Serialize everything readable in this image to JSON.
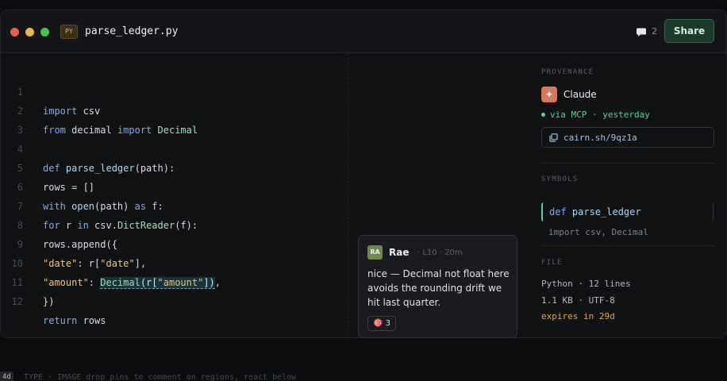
{
  "window": {
    "file_type": "PY",
    "filename": "parse_ledger.py",
    "comment_count": "2",
    "share_label": "Share"
  },
  "code": {
    "lines": [
      {
        "n": "1"
      },
      {
        "n": "2"
      },
      {
        "n": "3"
      },
      {
        "n": "4"
      },
      {
        "n": "5"
      },
      {
        "n": "6"
      },
      {
        "n": "7"
      },
      {
        "n": "8"
      },
      {
        "n": "9"
      },
      {
        "n": "10"
      },
      {
        "n": "11"
      },
      {
        "n": "12"
      }
    ],
    "t": {
      "import": "import",
      "csv": " csv",
      "from": "from",
      "decimal_mod": " decimal ",
      "import2": "import",
      "Decimal": " Decimal",
      "def": "def",
      "parse_ledger": " parse_ledger",
      "path_sig": "(path):",
      "rows_eq": "rows = []",
      "with": "with",
      "open": " open",
      "path_as": "(path) ",
      "as": "as",
      "f": " f:",
      "for": "for",
      "r": " r ",
      "in": "in",
      "csv_dot": " csv.",
      "DictReader": "DictReader",
      "f_paren": "(f):",
      "rows_append": "rows.append({",
      "date_key": "\"date\"",
      "colon_r": ": r[",
      "date_key2": "\"date\"",
      "close_comma": "],",
      "amount_key": "\"amount\"",
      "colon": ": ",
      "Decimal_call": "Decimal",
      "r_open": "(r[",
      "amount_key2": "\"amount\"",
      "close2": "])",
      "comma": ",",
      "close_brace": "})",
      "return": "return",
      "rows": " rows"
    }
  },
  "comment": {
    "initials": "RA",
    "author": "Rae",
    "meta": "· L10 · 20m",
    "body": "nice — Decimal not float here avoids the rounding drift we hit last quarter.",
    "reaction_emoji": "🎯",
    "reaction_count": "3"
  },
  "provenance": {
    "label": "PROVENANCE",
    "badge_glyph": "✦",
    "name": "Claude",
    "via": "via MCP · yesterday",
    "link": "cairn.sh/9qz1a"
  },
  "symbols": {
    "label": "SYMBOLS",
    "active_kw": "def",
    "active_name": " parse_ledger",
    "secondary": "import csv, Decimal"
  },
  "file": {
    "label": "FILE",
    "lang_lines": "Python · 12 lines",
    "size_enc": "1.1 KB · UTF-8",
    "expires": "expires in 29d"
  },
  "footer": {
    "badge": "4d",
    "text": "TYPE · IMAGE drop pins to comment on regions, react below"
  }
}
